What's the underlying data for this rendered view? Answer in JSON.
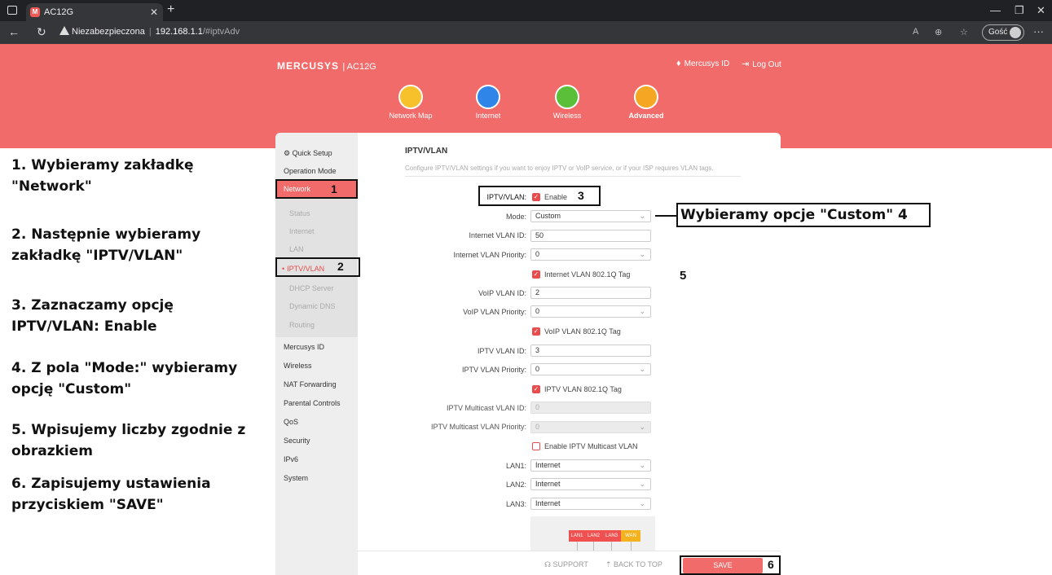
{
  "browser": {
    "tab_title": "AC12G",
    "tab_favicon": "M",
    "security_label": "Niezabezpieczona",
    "url_host": "192.168.1.1",
    "url_path": "/#iptvAdv",
    "guest_label": "Gość"
  },
  "router": {
    "brand": "MERCUSYS",
    "model": "| AC12G",
    "id_link": "Mercusys ID",
    "logout_link": "Log Out",
    "top_nav": [
      {
        "label": "Network Map",
        "color": "#f6c12b"
      },
      {
        "label": "Internet",
        "color": "#2f86e8"
      },
      {
        "label": "Wireless",
        "color": "#5bbf3a"
      },
      {
        "label": "Advanced",
        "color": "#f5a623"
      }
    ]
  },
  "sidebar": {
    "quick_setup": "Quick Setup",
    "operation_mode": "Operation Mode",
    "network": "Network",
    "sub_items": [
      "Status",
      "Internet",
      "LAN",
      "IPTV/VLAN",
      "DHCP Server",
      "Dynamic DNS",
      "Routing"
    ],
    "items": [
      "Mercusys ID",
      "Wireless",
      "NAT Forwarding",
      "Parental Controls",
      "QoS",
      "Security",
      "IPv6",
      "System"
    ]
  },
  "content": {
    "title": "IPTV/VLAN",
    "description": "Configure IPTV/VLAN settings if you want to enjoy IPTV or VoIP service, or if your ISP requires VLAN tags.",
    "iptv_vlan_label": "IPTV/VLAN:",
    "enable_label": "Enable",
    "mode_label": "Mode:",
    "mode_value": "Custom",
    "internet_vlan_id_label": "Internet VLAN ID:",
    "internet_vlan_id": "50",
    "internet_vlan_priority_label": "Internet VLAN Priority:",
    "internet_vlan_priority": "0",
    "internet_tag_label": "Internet VLAN 802.1Q Tag",
    "voip_vlan_id_label": "VoIP VLAN ID:",
    "voip_vlan_id": "2",
    "voip_vlan_priority_label": "VoIP VLAN Priority:",
    "voip_vlan_priority": "0",
    "voip_tag_label": "VoIP VLAN 802.1Q Tag",
    "iptv_vlan_id_label": "IPTV VLAN ID:",
    "iptv_vlan_id": "3",
    "iptv_vlan_priority_label": "IPTV VLAN Priority:",
    "iptv_vlan_priority": "0",
    "iptv_tag_label": "IPTV VLAN 802.1Q Tag",
    "multicast_vlan_id_label": "IPTV Multicast VLAN ID:",
    "multicast_vlan_id": "0",
    "multicast_vlan_priority_label": "IPTV Multicast VLAN Priority:",
    "multicast_vlan_priority": "0",
    "enable_multicast_label": "Enable IPTV Multicast VLAN",
    "lan1_label": "LAN1:",
    "lan1_value": "Internet",
    "lan2_label": "LAN2:",
    "lan2_value": "Internet",
    "lan3_label": "LAN3:",
    "lan3_value": "Internet",
    "ports": [
      "LAN1",
      "LAN2",
      "LAN3",
      "WAN"
    ]
  },
  "footer": {
    "support": "SUPPORT",
    "back_to_top": "BACK TO TOP",
    "save": "SAVE"
  },
  "annotations": {
    "step1": "1. Wybieramy zakładkę \"Network\"",
    "step2": "2. Następnie wybieramy zakładkę \"IPTV/VLAN\"",
    "step3": "3. Zaznaczamy opcję IPTV/VLAN: Enable",
    "step4": "4. Z pola \"Mode:\" wybieramy opcję \"Custom\"",
    "step5": "5. Wpisujemy liczby zgodnie z obrazkiem",
    "step6": "6. Zapisujemy ustawienia przyciskiem \"SAVE\"",
    "custom_callout": "Wybieramy opcje \"Custom\"  4",
    "n1": "1",
    "n2": "2",
    "n3": "3",
    "n5": "5",
    "n6": "6"
  }
}
